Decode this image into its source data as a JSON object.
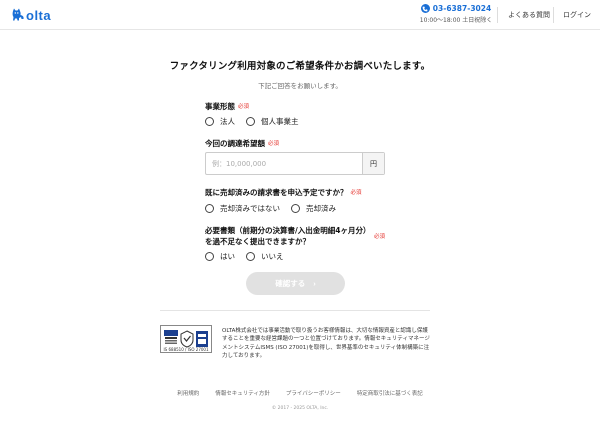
{
  "header": {
    "logo_text": "olta",
    "phone_number": "03-6387-3024",
    "phone_hours": "10:00～18:00 土日祝除く",
    "faq_link": "よくある質問",
    "login_link": "ログイン",
    "brand_color": "#1a6fd6"
  },
  "form": {
    "title": "ファクタリング利用対象のご希望条件かお調べいたします。",
    "subtitle": "下記ご回答をお願いします。",
    "required_badge": "必須",
    "q1": {
      "label": "事業形態",
      "options": [
        "法人",
        "個人事業主"
      ]
    },
    "q2": {
      "label": "今回の調達希望額",
      "placeholder": "例：10,000,000",
      "unit": "円"
    },
    "q3": {
      "label": "既に売却済みの請求書を申込予定ですか？",
      "options": [
        "売却済みではない",
        "売却済み"
      ]
    },
    "q4": {
      "label_line1": "必要書類（前期分の決算書/入出金明細4ヶ月分）",
      "label_line2": "を過不足なく提出できますか？",
      "options": [
        "はい",
        "いいえ"
      ]
    },
    "confirm_button": "確認する",
    "confirm_arrow": "›",
    "required_color": "#e4312b"
  },
  "certification": {
    "badge_caption": "IS 688510 / ISO 27001",
    "text": "OLTA株式会社では事業活動で取り扱うお客様情報は、大切な情報資産と認識し保護することを重要な経営課題の一つと位置づけております。情報セキュリティマネージメントシステムISMS (ISO 27001)を取得し、世界基準のセキュリティ体制構築に注力しております。"
  },
  "footer": {
    "links": [
      "利用規約",
      "情報セキュリティ方針",
      "プライバシーポリシー",
      "特定商取引法に基づく表記"
    ],
    "copyright": "© 2017 - 2025 OLTA, Inc."
  }
}
